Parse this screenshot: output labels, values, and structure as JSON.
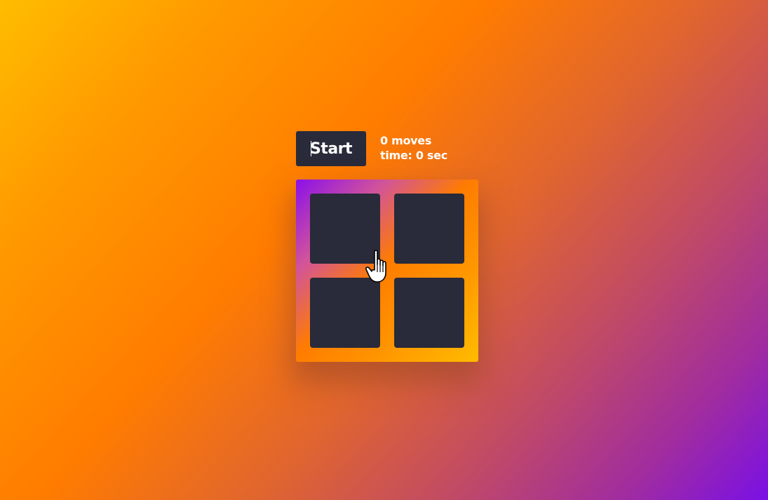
{
  "controls": {
    "start_label": "Start",
    "moves_text": "0 moves",
    "time_text": "time: 0 sec"
  },
  "board": {
    "rows": 2,
    "columns": 2,
    "cards": [
      {
        "state": "face-down"
      },
      {
        "state": "face-down"
      },
      {
        "state": "face-down"
      },
      {
        "state": "face-down"
      }
    ]
  },
  "colors": {
    "card_back": "#292a3a",
    "button_bg": "#292a3a",
    "text": "#ffffff",
    "background_start": "#ffbd00",
    "background_mid": "#ff7c00",
    "background_end": "#7a10e6"
  },
  "icons": {
    "cursor": "hand-pointer-icon"
  }
}
